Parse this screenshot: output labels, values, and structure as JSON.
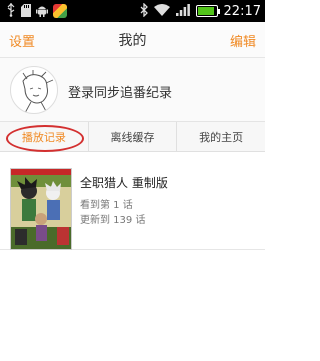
{
  "statusbar": {
    "time": "22:17",
    "battery_level_percent": 90
  },
  "header": {
    "left_label": "设置",
    "title": "我的",
    "right_label": "编辑"
  },
  "profile": {
    "login_text": "登录同步追番纪录"
  },
  "tabs": [
    {
      "label": "播放记录",
      "active": true
    },
    {
      "label": "离线缓存",
      "active": false
    },
    {
      "label": "我的主页",
      "active": false
    }
  ],
  "history": [
    {
      "title": "全职猎人 重制版",
      "watched": "看到第 1 话",
      "updated": "更新到 139 话"
    }
  ],
  "colors": {
    "accent": "#f08a24",
    "highlight_circle": "#d32f2f"
  },
  "icons": [
    "usb-icon",
    "sd-card-icon",
    "android-icon",
    "app-icon",
    "bluetooth-icon",
    "wifi-icon",
    "signal-icon",
    "battery-icon"
  ]
}
